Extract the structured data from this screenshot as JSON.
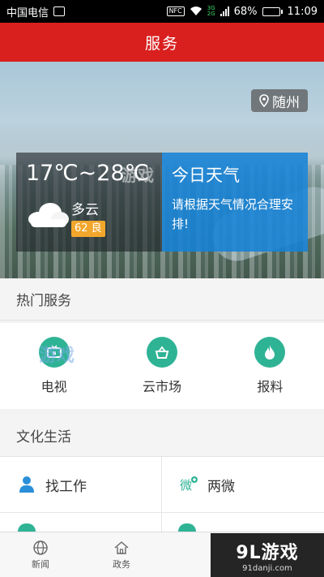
{
  "status_bar": {
    "carrier": "中国电信",
    "nfc": "NFC",
    "net_top": "3G",
    "net_bottom": "2G",
    "battery": "68%",
    "battery_level": 0.68,
    "time": "11:09"
  },
  "title": "服务",
  "hero": {
    "city": "随州",
    "temperature": "17℃~28℃",
    "condition": "多云",
    "aqi": "62 良",
    "today_title": "今日天气",
    "advice": "请根据天气情况合理安排!"
  },
  "hot_services": {
    "title": "热门服务",
    "items": [
      {
        "label": "电视",
        "icon": "tv-icon"
      },
      {
        "label": "云市场",
        "icon": "shopping-bag-icon"
      },
      {
        "label": "报料",
        "icon": "flame-icon"
      }
    ]
  },
  "culture": {
    "title": "文化生活",
    "items": [
      {
        "label": "找工作",
        "icon": "person-icon"
      },
      {
        "label": "两微",
        "icon": "weibo-plus-icon"
      }
    ]
  },
  "bottom_nav": {
    "items": [
      {
        "label": "新闻",
        "icon": "globe-icon"
      },
      {
        "label": "政务",
        "icon": "home-icon"
      }
    ]
  },
  "watermark": {
    "brand": "9L游戏",
    "url": "91danji.com",
    "overlay": "游戏"
  },
  "colors": {
    "title_bar": "#d9201f",
    "service_icon": "#2fb395",
    "weather_blue": "#1682d6",
    "aqi_badge": "#f2a72c"
  }
}
